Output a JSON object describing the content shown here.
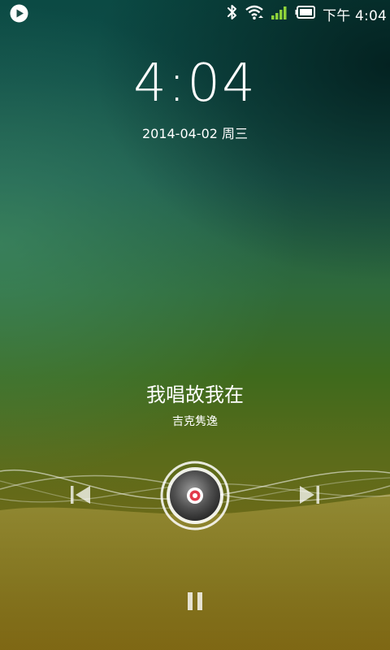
{
  "status_bar": {
    "time": "下午 4:04",
    "icons": [
      "play-notification-icon",
      "bluetooth-icon",
      "wifi-icon",
      "signal-icon",
      "battery-icon"
    ]
  },
  "lockscreen": {
    "clock": "4:04",
    "date": "2014-04-02 周三"
  },
  "music": {
    "title": "我唱故我在",
    "artist": "吉克隽逸",
    "controls": [
      "previous-icon",
      "album-disc",
      "next-icon",
      "pause-icon"
    ]
  },
  "colors": {
    "accent_signal": "#8ed23a",
    "disc_center": "#e23a4a",
    "text": "#ffffff"
  }
}
